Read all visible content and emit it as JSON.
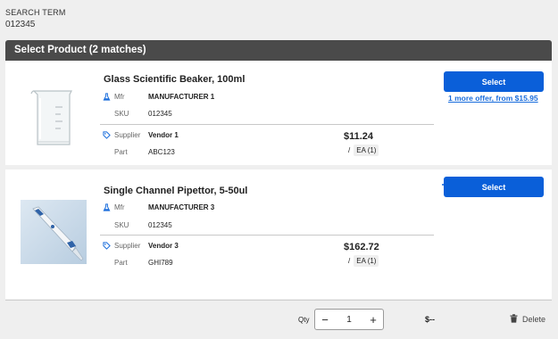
{
  "search": {
    "label": "SEARCH TERM",
    "value": "012345"
  },
  "header": {
    "title": "Select Product (2 matches)"
  },
  "products": [
    {
      "title": "Glass Scientific Beaker, 100ml",
      "mfr_label": "Mfr",
      "mfr_value": "MANUFACTURER 1",
      "sku_label": "SKU",
      "sku_value": "012345",
      "supplier_label": "Supplier",
      "supplier_value": "Vendor 1",
      "part_label": "Part",
      "part_value": "ABC123",
      "price": "$11.24",
      "uom_sep": "/",
      "uom": "EA (1)",
      "select_label": "Select",
      "offer_link": "1 more offer, from $15.95",
      "image": "beaker-photo"
    },
    {
      "title": "Single Channel Pipettor, 5-50ul",
      "mfr_label": "Mfr",
      "mfr_value": "MANUFACTURER 3",
      "sku_label": "SKU",
      "sku_value": "012345",
      "supplier_label": "Supplier",
      "supplier_value": "Vendor 3",
      "part_label": "Part",
      "part_value": "GHI789",
      "price": "$162.72",
      "uom_sep": "/",
      "uom": "EA (1)",
      "select_label": "Select",
      "image": "pipettor-photo"
    }
  ],
  "footer": {
    "qty_label": "Qty",
    "qty_value": "1",
    "minus": "−",
    "plus": "+",
    "total": "$--",
    "delete_label": "Delete"
  },
  "colors": {
    "accent": "#0a5fd9",
    "header_bg": "#4a4a4a",
    "link": "#1a6ddc"
  },
  "icons": [
    "flask-icon",
    "tag-icon",
    "trash-icon",
    "minus-icon",
    "plus-icon"
  ]
}
